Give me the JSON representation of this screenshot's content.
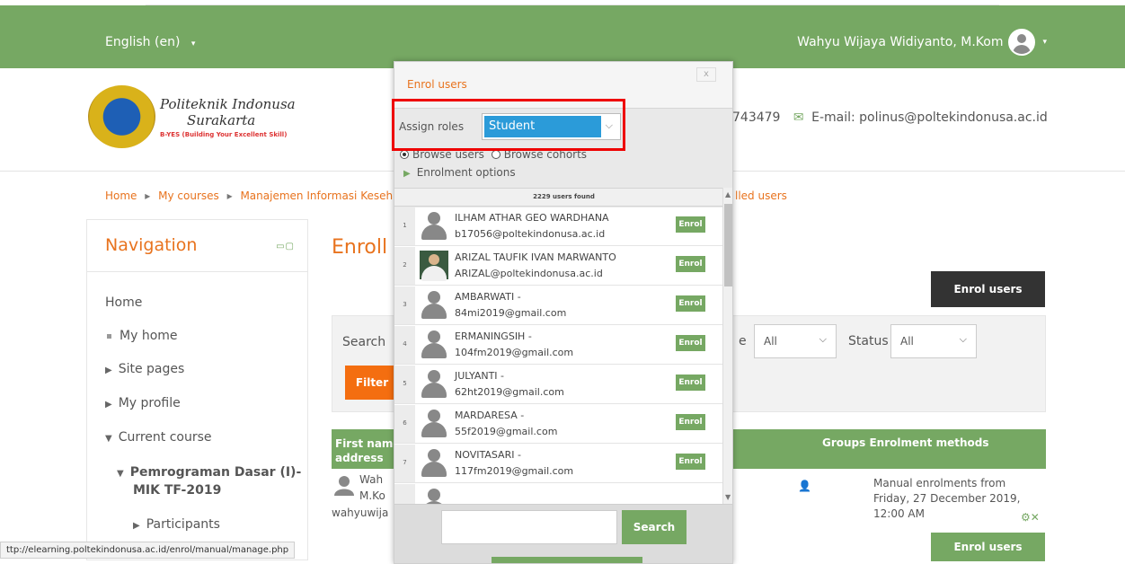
{
  "header": {
    "language": "English (en)",
    "user_name": "Wahyu Wijaya Widiyanto, M.Kom"
  },
  "logo": {
    "line1": "Politeknik Indonusa",
    "line2": "Surakarta",
    "tagline": "B-YES (Building Your Excellent Skill)"
  },
  "contact": {
    "phone_partial": "743479",
    "email_label": "E-mail: polinus@poltekindonusa.ac.id"
  },
  "breadcrumb": {
    "home": "Home",
    "my_courses": "My courses",
    "course": "Manajemen Informasi Keseh",
    "tail": "lled users"
  },
  "navigation": {
    "title": "Navigation",
    "home": "Home",
    "my_home": "My home",
    "site_pages": "Site pages",
    "my_profile": "My profile",
    "current_course": "Current course",
    "course_name_1": "Pemrograman Dasar (I)-",
    "course_name_2": "MIK TF-2019",
    "participants": "Participants"
  },
  "main": {
    "title": "Enroll",
    "enrol_users_btn": "Enrol users",
    "search_label": "Search",
    "role_suffix": "e",
    "role_value": "All",
    "status_label": "Status",
    "status_value": "All",
    "filter_btn": "Filter",
    "col_first": "First name",
    "col_address": "address",
    "col_groups": "Groups",
    "col_methods": "Enrolment methods",
    "row_name1": "Wah",
    "row_name2": "M.Ko",
    "row_email": "wahyuwija",
    "row_method": "Manual enrolments from Friday, 27 December 2019, 12:00 AM",
    "enrol_users_btn_bottom": "Enrol users"
  },
  "status_bar": "ttp://elearning.poltekindonusa.ac.id/enrol/manual/manage.php",
  "modal": {
    "title": "Enrol users",
    "close": "x",
    "assign_roles_label": "Assign roles",
    "role_selected": "Student",
    "browse_users": "Browse users",
    "browse_cohorts": "Browse cohorts",
    "enrolment_options": "Enrolment options",
    "users_found": "2229 users found",
    "enrol_label": "Enrol",
    "search_btn": "Search",
    "users": [
      {
        "num": "1",
        "name": "ILHAM ATHAR GEO WARDHANA",
        "email": "b17056@poltekindonusa.ac.id"
      },
      {
        "num": "2",
        "name": "ARIZAL TAUFIK IVAN MARWANTO",
        "email": "ARIZAL@poltekindonusa.ac.id"
      },
      {
        "num": "3",
        "name": "AMBARWATI -",
        "email": "84mi2019@gmail.com"
      },
      {
        "num": "4",
        "name": "ERMANINGSIH -",
        "email": "104fm2019@gmail.com"
      },
      {
        "num": "5",
        "name": "JULYANTI -",
        "email": "62ht2019@gmail.com"
      },
      {
        "num": "6",
        "name": "MARDARESA -",
        "email": "55f2019@gmail.com"
      },
      {
        "num": "7",
        "name": "NOVITASARI -",
        "email": "117fm2019@gmail.com"
      }
    ]
  },
  "colors": {
    "brand_green": "#76a863",
    "accent_orange": "#e8731e",
    "filter_orange": "#f46e10",
    "select_blue": "#2b9bd9",
    "highlight_red": "#ee0000"
  }
}
